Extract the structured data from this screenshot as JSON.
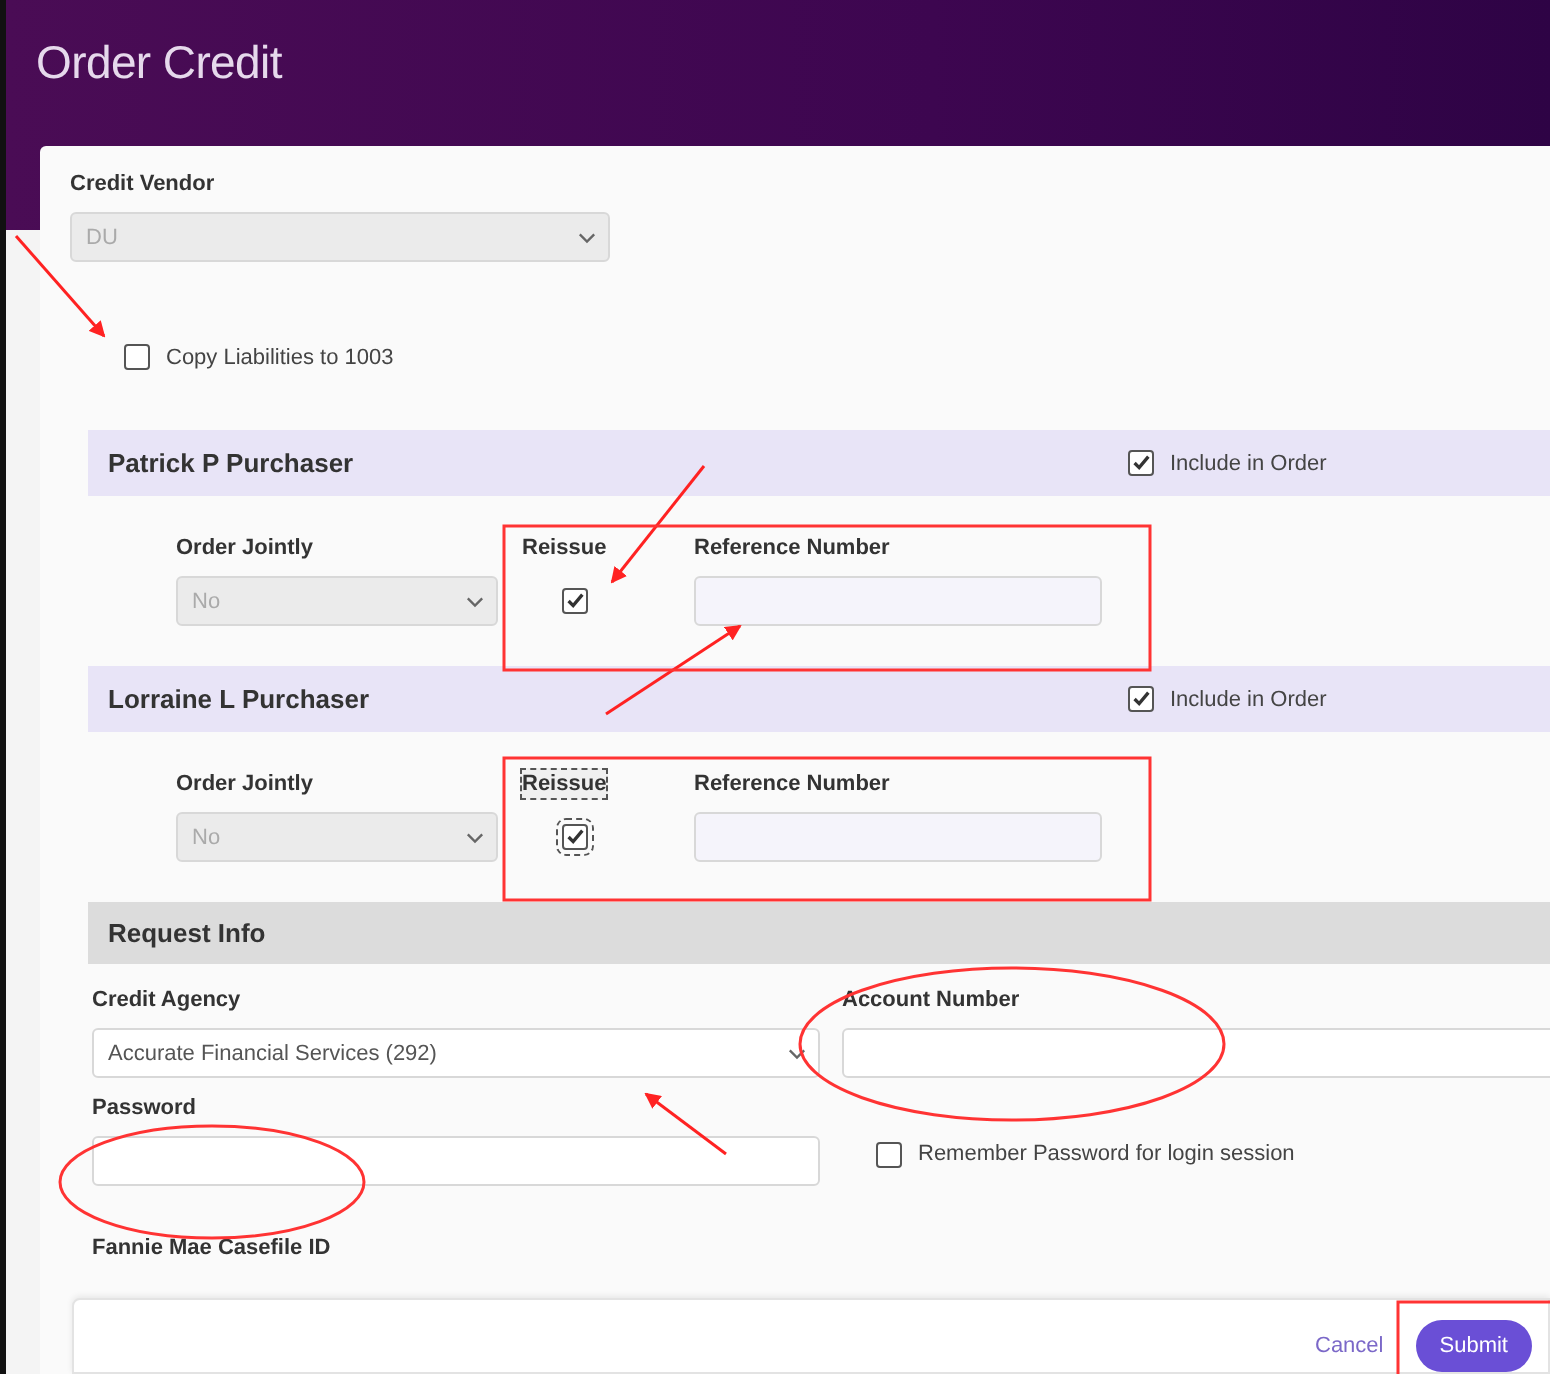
{
  "window": {
    "title": "Order Credit"
  },
  "credit_vendor": {
    "label": "Credit Vendor",
    "value": "DU",
    "disabled": true
  },
  "copy_liabilities": {
    "label": "Copy Liabilities to 1003",
    "checked": false
  },
  "borrowers": [
    {
      "name": "Patrick P Purchaser",
      "include": {
        "label": "Include in Order",
        "checked": true
      },
      "order_jointly": {
        "label": "Order Jointly",
        "value": "No",
        "disabled": true
      },
      "reissue": {
        "label": "Reissue",
        "checked": true,
        "focused": false
      },
      "reference_number": {
        "label": "Reference Number"
      }
    },
    {
      "name": "Lorraine L Purchaser",
      "include": {
        "label": "Include in Order",
        "checked": true
      },
      "order_jointly": {
        "label": "Order Jointly",
        "value": "No",
        "disabled": true
      },
      "reissue": {
        "label": "Reissue",
        "checked": true,
        "focused": true
      },
      "reference_number": {
        "label": "Reference Number"
      }
    }
  ],
  "request_info": {
    "title": "Request Info",
    "credit_agency": {
      "label": "Credit Agency",
      "value": "Accurate Financial Services (292)",
      "disabled": false
    },
    "account_number": {
      "label": "Account Number"
    },
    "password": {
      "label": "Password"
    },
    "remember_password": {
      "label": "Remember Password for login session",
      "checked": false
    },
    "fannie_mae_casefile_id": {
      "label": "Fannie Mae Casefile ID"
    }
  },
  "footer": {
    "buttons": [
      {
        "label": "Cancel",
        "kind": "link"
      },
      {
        "label": "Submit",
        "kind": "primary"
      }
    ]
  }
}
